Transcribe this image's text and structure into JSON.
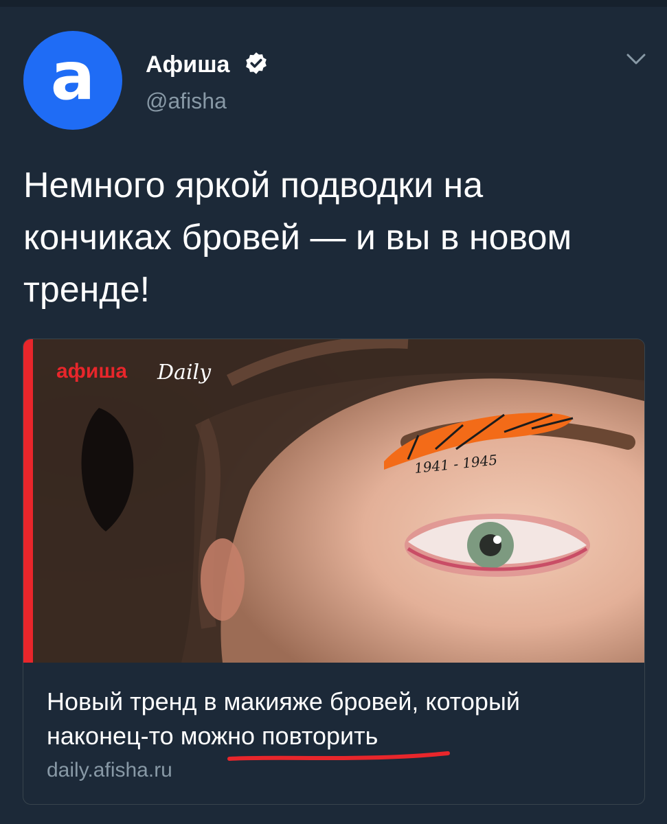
{
  "author": {
    "display_name": "Афиша",
    "handle": "@afisha",
    "avatar_letter": "а",
    "verified_icon": "verified-badge-icon",
    "brand_color": "#1f6cf5"
  },
  "tweet": {
    "text": "Немного яркой подводки на кончиках бровей — и вы в новом тренде!"
  },
  "card": {
    "image": {
      "logo_text_afisha": "афиша",
      "logo_text_daily": "Daily",
      "eyebrow_annotation": "1941 - 1945",
      "annotation_color": "#f36b18",
      "logo_color": "#e8262b"
    },
    "title": "Новый тренд в макияже бровей, который наконец-то можно повторить",
    "domain": "daily.afisha.ru",
    "underline_color": "#e8262b"
  },
  "menu": {
    "icon": "chevron-down-icon"
  }
}
